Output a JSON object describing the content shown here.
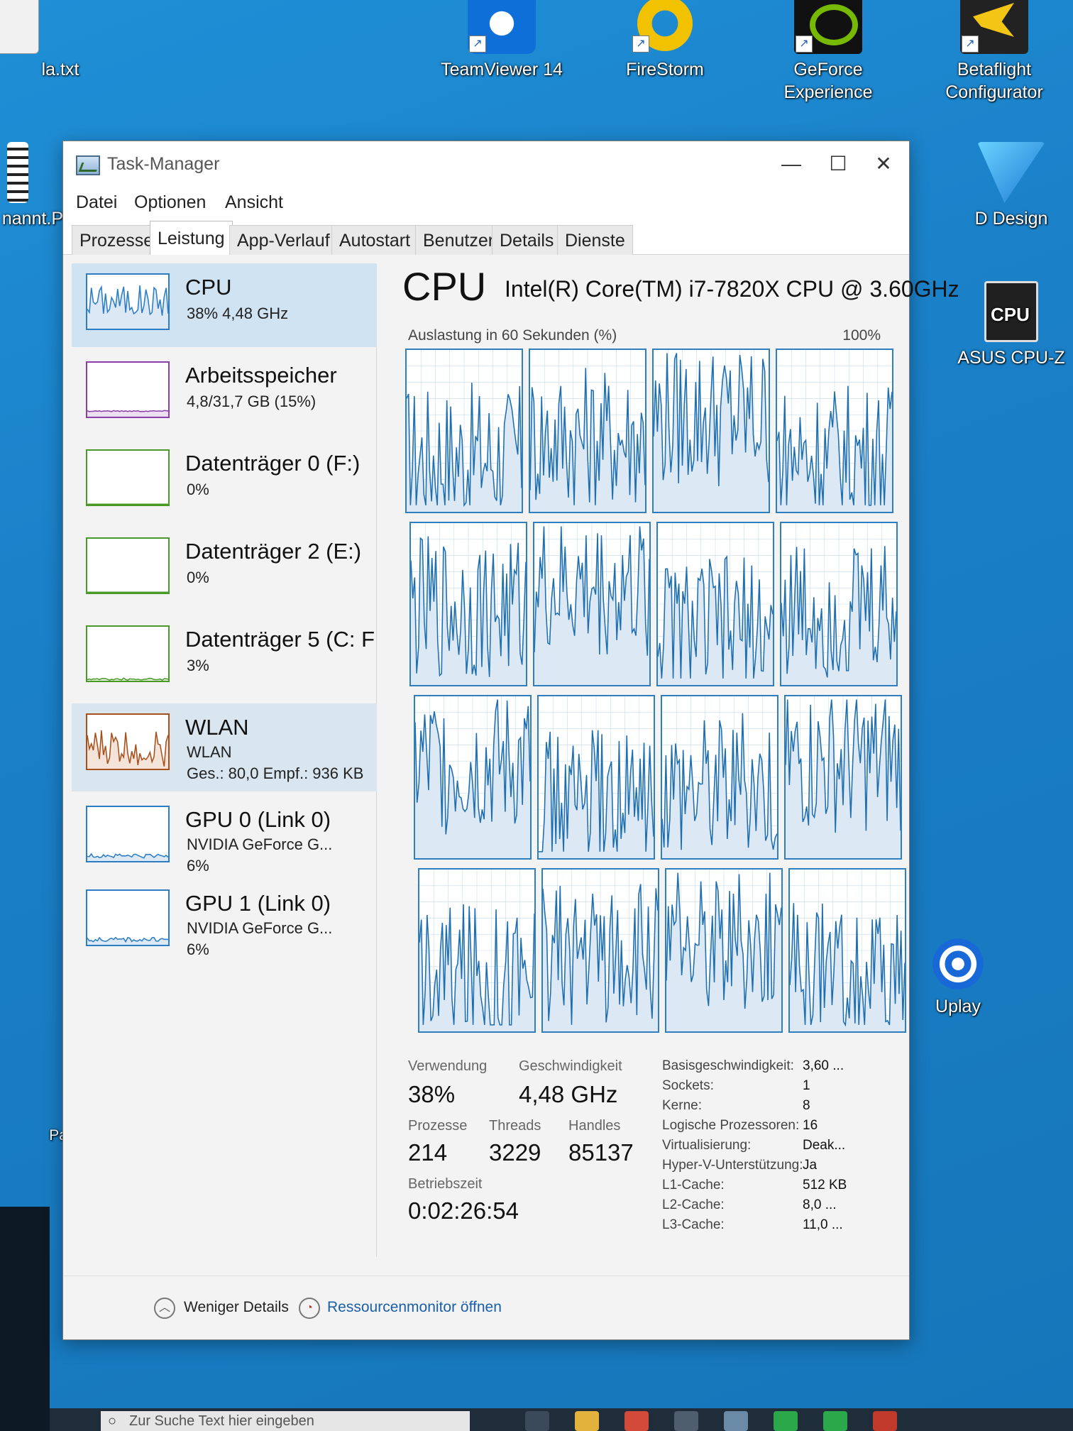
{
  "desktop": {
    "icons": [
      {
        "label": "la.txt",
        "icon": "text-file-icon"
      },
      {
        "label": "nannt.PN",
        "icon": "image-file-icon"
      },
      {
        "label": "TeamViewer 14",
        "icon": "teamviewer-icon"
      },
      {
        "label": "FireStorm",
        "icon": "firestorm-icon"
      },
      {
        "label": "GeForce Experience",
        "icon": "geforce-icon"
      },
      {
        "label": "Betaflight",
        "label2": "Configurator",
        "icon": "betaflight-icon"
      },
      {
        "label": "D Design",
        "icon": "design-app-icon"
      },
      {
        "label": "ASUS CPU-Z",
        "icon": "cpuz-icon"
      },
      {
        "label": "Uplay",
        "icon": "uplay-icon"
      },
      {
        "label": "Papierkorb",
        "icon": "recycle-bin-icon"
      }
    ],
    "taskbar_search_placeholder": "Zur Suche Text hier eingeben"
  },
  "window": {
    "title": "Task-Manager",
    "controls": {
      "minimize": "—",
      "maximize": "☐",
      "close": "✕"
    }
  },
  "menu": [
    "Datei",
    "Optionen",
    "Ansicht"
  ],
  "tabs": [
    "Prozesse",
    "Leistung",
    "App-Verlauf",
    "Autostart",
    "Benutzer",
    "Details",
    "Dienste"
  ],
  "active_tab": "Leistung",
  "sidebar": [
    {
      "name": "CPU",
      "sub1": "38% 4,48 GHz",
      "color": "#2c7dc4"
    },
    {
      "name": "Arbeitsspeicher",
      "sub1": "4,8/31,7 GB (15%)",
      "color": "#8b3fa8"
    },
    {
      "name": "Datenträger 0 (F:)",
      "sub1": "0%",
      "color": "#4a9a2a"
    },
    {
      "name": "Datenträger 2 (E:)",
      "sub1": "0%",
      "color": "#4a9a2a"
    },
    {
      "name": "Datenträger 5 (C: F",
      "sub1": "3%",
      "color": "#4a9a2a"
    },
    {
      "name": "WLAN",
      "sub1": "WLAN",
      "sub2": "Ges.: 80,0 Empf.: 936 KB",
      "color": "#a8501c"
    },
    {
      "name": "GPU 0 (Link 0)",
      "sub1": "NVIDIA GeForce G...",
      "sub2": "6%",
      "color": "#2c7dc4"
    },
    {
      "name": "GPU 1 (Link 0)",
      "sub1": "NVIDIA GeForce G...",
      "sub2": "6%",
      "color": "#2c7dc4"
    }
  ],
  "cpu": {
    "heading": "CPU",
    "model": "Intel(R) Core(TM) i7-7820X CPU @ 3.60GHz",
    "chart_caption": "Auslastung in 60 Sekunden (%)",
    "chart_max": "100%",
    "line_color": "#1f6fb0",
    "fill_color": "#dce9f4",
    "stats": {
      "usage_label": "Verwendung",
      "usage": "38%",
      "speed_label": "Geschwindigkeit",
      "speed": "4,48 GHz",
      "processes_label": "Prozesse",
      "processes": "214",
      "threads_label": "Threads",
      "threads": "3229",
      "handles_label": "Handles",
      "handles": "85137",
      "uptime_label": "Betriebszeit",
      "uptime": "0:02:26:54"
    },
    "details": [
      {
        "key": "Basisgeschwindigkeit:",
        "value": "3,60 ..."
      },
      {
        "key": "Sockets:",
        "value": "1"
      },
      {
        "key": "Kerne:",
        "value": "8"
      },
      {
        "key": "Logische Prozessoren:",
        "value": "16"
      },
      {
        "key": "Virtualisierung:",
        "value": "Deak..."
      },
      {
        "key": "Hyper-V-Unterstützung:",
        "value": "Ja"
      },
      {
        "key": "L1-Cache:",
        "value": "512 KB"
      },
      {
        "key": "L2-Cache:",
        "value": "8,0 ..."
      },
      {
        "key": "L3-Cache:",
        "value": "11,0 ..."
      }
    ]
  },
  "footer": {
    "less_details": "Weniger Details",
    "resource_monitor": "Ressourcenmonitor öffnen"
  }
}
